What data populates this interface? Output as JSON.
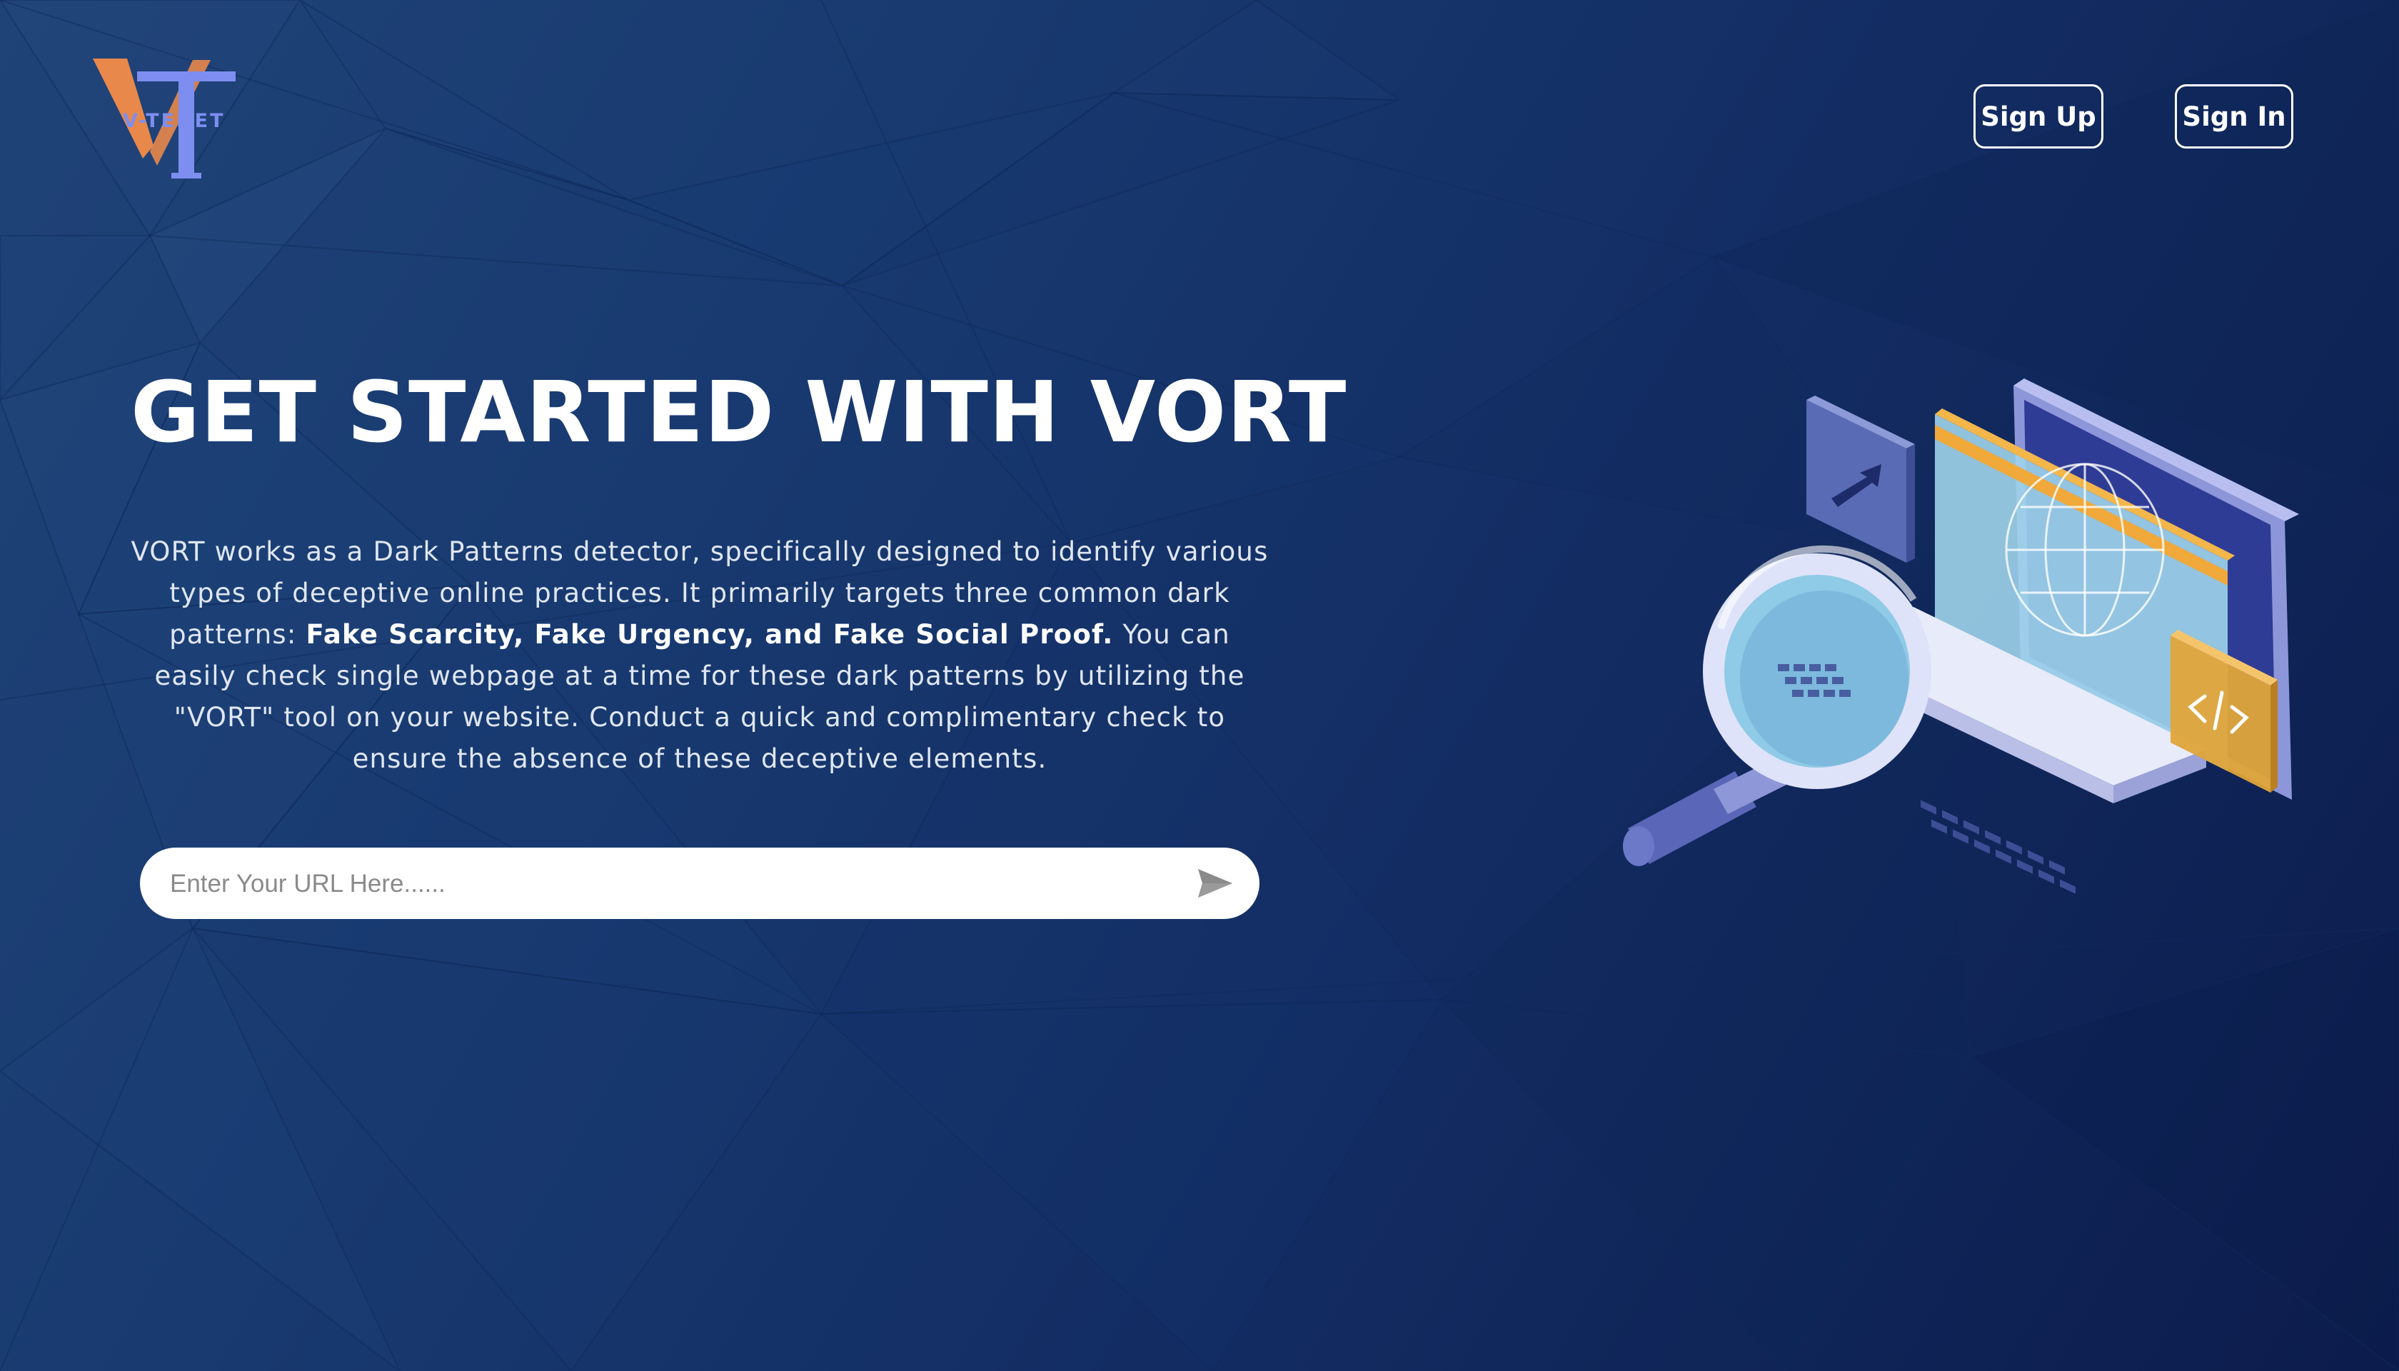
{
  "brand": {
    "logo_text": "V-TENET",
    "colors": {
      "accent_orange": "#e8884a",
      "accent_periwinkle": "#7d8ef0",
      "background_dark": "#132d63"
    }
  },
  "nav": {
    "signup_label": "Sign Up",
    "signin_label": "Sign In"
  },
  "hero": {
    "title": "GET STARTED WITH VORT",
    "description_1": "VORT works as a Dark Patterns detector, specifically designed to identify various types of deceptive online practices. It primarily targets three common dark patterns: ",
    "description_bold": "Fake Scarcity, Fake Urgency, and Fake Social Proof.",
    "description_2": " You can easily check single webpage at a time for these dark patterns by utilizing the \"VORT\" tool on your website. Conduct a quick and complimentary check to ensure the absence of these deceptive elements."
  },
  "search": {
    "placeholder": "Enter Your URL Here......",
    "value": "",
    "submit_icon": "send-icon"
  },
  "illustration": {
    "icons": [
      "magnifier-icon",
      "laptop-icon",
      "globe-icon",
      "arrow-icon",
      "code-icon"
    ]
  }
}
